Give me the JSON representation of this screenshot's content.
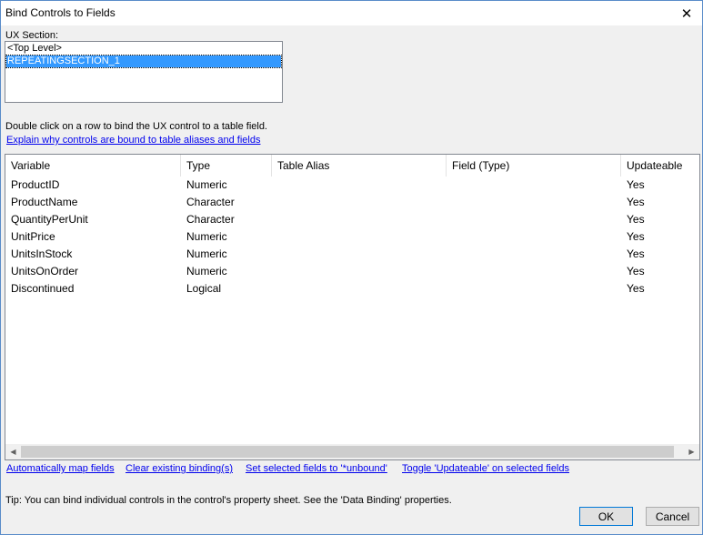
{
  "window": {
    "title": "Bind Controls to Fields",
    "close_glyph": "✕"
  },
  "ux_section": {
    "label": "UX Section:",
    "items": [
      {
        "label": "<Top Level>",
        "selected": false
      },
      {
        "label": "REPEATINGSECTION_1",
        "selected": true
      }
    ]
  },
  "instructions": {
    "hint": "Double click on a row to bind the UX control to a table field.",
    "explain_link": "Explain why controls are bound to table aliases and fields"
  },
  "grid": {
    "columns": [
      "Variable",
      "Type",
      "Table Alias",
      "Field (Type)",
      "Updateable"
    ],
    "rows": [
      {
        "variable": "ProductID",
        "type": "Numeric",
        "table_alias": "",
        "field_type": "",
        "updateable": "Yes"
      },
      {
        "variable": "ProductName",
        "type": "Character",
        "table_alias": "",
        "field_type": "",
        "updateable": "Yes"
      },
      {
        "variable": "QuantityPerUnit",
        "type": "Character",
        "table_alias": "",
        "field_type": "",
        "updateable": "Yes"
      },
      {
        "variable": "UnitPrice",
        "type": "Numeric",
        "table_alias": "",
        "field_type": "",
        "updateable": "Yes"
      },
      {
        "variable": "UnitsInStock",
        "type": "Numeric",
        "table_alias": "",
        "field_type": "",
        "updateable": "Yes"
      },
      {
        "variable": "UnitsOnOrder",
        "type": "Numeric",
        "table_alias": "",
        "field_type": "",
        "updateable": "Yes"
      },
      {
        "variable": "Discontinued",
        "type": "Logical",
        "table_alias": "",
        "field_type": "",
        "updateable": "Yes"
      }
    ]
  },
  "scrollbar": {
    "left_arrow": "◀",
    "right_arrow": "▶"
  },
  "actions": {
    "auto_map": "Automatically map fields",
    "clear_bindings": "Clear existing binding(s)",
    "set_unbound": "Set selected fields to '*unbound'",
    "toggle_updateable": "Toggle 'Updateable' on selected fields"
  },
  "footer": {
    "tip": "Tip: You can bind individual controls in the control's property sheet. See the 'Data Binding' properties.",
    "ok_label": "OK",
    "cancel_label": "Cancel"
  },
  "colors": {
    "link": "#0000ee",
    "selection": "#3399ff",
    "window_border": "#5a8cc9"
  }
}
